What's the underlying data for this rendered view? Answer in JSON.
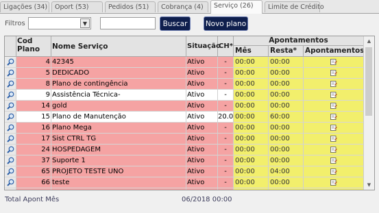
{
  "tabs": [
    {
      "label": "Ligações (34)",
      "active": false
    },
    {
      "label": "Oport (53)",
      "active": false
    },
    {
      "label": "Pedidos (51)",
      "active": false
    },
    {
      "label": "Cobrança (4)",
      "active": false
    },
    {
      "label": "Serviço (26)",
      "active": true
    },
    {
      "label": "Limite de Crédito",
      "active": false
    }
  ],
  "filters": {
    "label": "Filtros",
    "select_value": "",
    "text_value": "",
    "search_button": "Buscar",
    "new_button": "Novo plano"
  },
  "grid": {
    "headers": {
      "cod": "Cod Plano",
      "nome": "Nome Serviço",
      "situacao": "Situação",
      "ch": "CH*",
      "group": "Apontamentos",
      "mes": "Mês",
      "resta": "Resta*",
      "apontamentos": "Apontamentos"
    },
    "rows": [
      {
        "cod": "4",
        "nome": "42345",
        "situacao": "Ativo",
        "ch": "-",
        "mes": "00:00",
        "resta": "00:00",
        "color": "pink"
      },
      {
        "cod": "5",
        "nome": "DEDICADO",
        "situacao": "Ativo",
        "ch": "-",
        "mes": "00:00",
        "resta": "00:00",
        "color": "pink"
      },
      {
        "cod": "8",
        "nome": "Plano de contingência",
        "situacao": "Ativo",
        "ch": "-",
        "mes": "00:00",
        "resta": "00:00",
        "color": "pink"
      },
      {
        "cod": "9",
        "nome": "Assistência Técnica-",
        "situacao": "Ativo",
        "ch": "-",
        "mes": "00:00",
        "resta": "00:00",
        "color": "white"
      },
      {
        "cod": "14",
        "nome": "gold",
        "situacao": "Ativo",
        "ch": "-",
        "mes": "00:00",
        "resta": "00:00",
        "color": "pink"
      },
      {
        "cod": "15",
        "nome": "Plano de Manutenção",
        "situacao": "Ativo",
        "ch": "20.00",
        "mes": "00:00",
        "resta": "60:00",
        "color": "white"
      },
      {
        "cod": "16",
        "nome": "Plano Mega",
        "situacao": "Ativo",
        "ch": "-",
        "mes": "00:00",
        "resta": "00:00",
        "color": "pink"
      },
      {
        "cod": "17",
        "nome": "Sist CTRL TG",
        "situacao": "Ativo",
        "ch": "-",
        "mes": "00:00",
        "resta": "00:00",
        "color": "pink"
      },
      {
        "cod": "24",
        "nome": "HOSPEDAGEM",
        "situacao": "Ativo",
        "ch": "-",
        "mes": "00:00",
        "resta": "00:00",
        "color": "pink"
      },
      {
        "cod": "37",
        "nome": "Suporte 1",
        "situacao": "Ativo",
        "ch": "-",
        "mes": "00:00",
        "resta": "00:00",
        "color": "pink"
      },
      {
        "cod": "65",
        "nome": "PROJETO TESTE UNO",
        "situacao": "Ativo",
        "ch": "-",
        "mes": "00:00",
        "resta": "04:00",
        "color": "pink"
      },
      {
        "cod": "66",
        "nome": "teste",
        "situacao": "Ativo",
        "ch": "-",
        "mes": "00:00",
        "resta": "00:00",
        "color": "pink"
      },
      {
        "cod": "",
        "nome": "",
        "situacao": "",
        "ch": "",
        "mes": "",
        "resta": "",
        "color": "pink"
      }
    ]
  },
  "footer": {
    "label": "Total Apont Mês",
    "value": "06/2018 00:00"
  },
  "colors": {
    "pink_row": "#f5a3a3",
    "yellow_cells": "#f2ef6c",
    "button_bg": "#0f1f4d"
  }
}
